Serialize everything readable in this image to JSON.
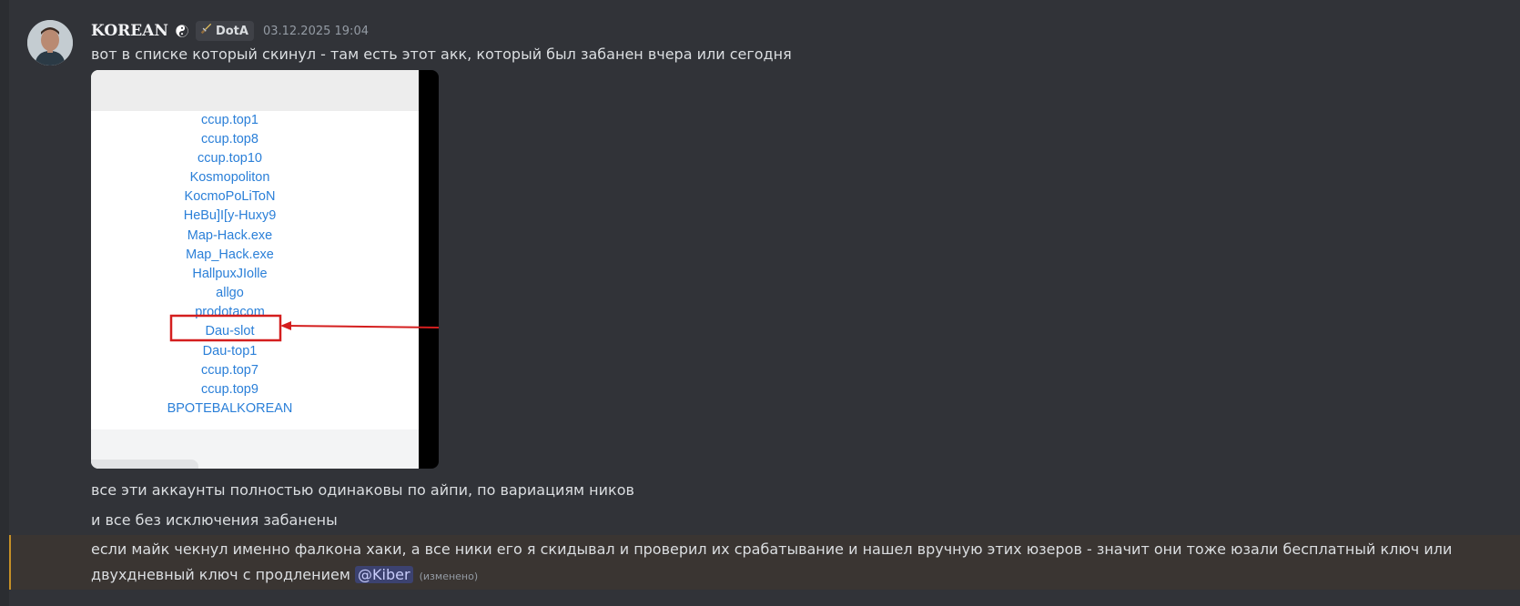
{
  "message": {
    "author": "KOREAN",
    "role_tag": "DotA",
    "timestamp": "03.12.2025 19:04",
    "line1": "вот в списке который скинул - там есть этот акк, который был забанен вчера или сегодня",
    "line2": "все эти аккаунты полностью одинаковы по айпи, по вариациям ников",
    "line3": "и все без исключения забанены",
    "line4_text": "если майк чекнул именно фалкона хаки, а все ники его я скидывал и проверил их срабатывание и нашел вручную этих юзеров - значит они тоже юзали бесплатный ключ или двухдневный ключ с продлением",
    "mention": "@Kiber",
    "edited": "(изменено)"
  },
  "attachment": {
    "nicknames": [
      "ccup.top1",
      "ccup.top8",
      "ccup.top10",
      "Kosmopoliton",
      "KocmoPoLiToN",
      "HeBu]I[y-Huxy9",
      "Map-Hack.exe",
      "Map_Hack.exe",
      "HallpuxJIolle",
      "allgo",
      "prodotacom",
      "Dau-slot",
      "Dau-top1",
      "ccup.top7",
      "ccup.top9",
      "BPOTEBALKOREAN"
    ],
    "highlighted_nickname": "Dau-slot",
    "highlight_color": "#d41e1e"
  },
  "colors": {
    "background": "#313338",
    "text": "#dbdee1",
    "link_blue": "#2a7fd8",
    "mention_bg": "#3c4270",
    "highlight_bg": "#3a3532",
    "highlight_bar": "#c69026"
  },
  "icons": {
    "yin_yang": "yin-yang-icon",
    "role_icon": "sword-icon"
  }
}
